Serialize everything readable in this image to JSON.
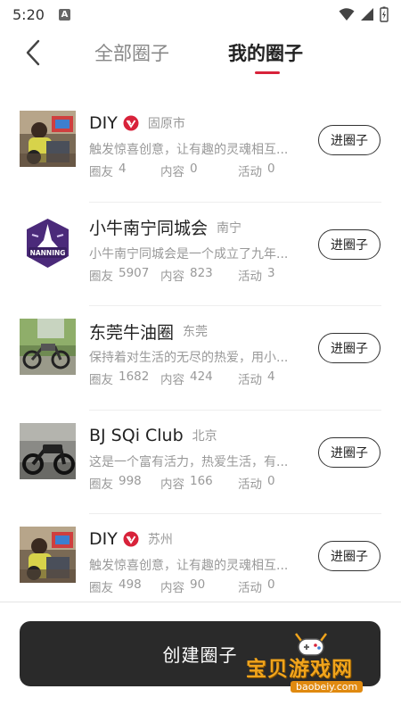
{
  "status_bar": {
    "time": "5:20",
    "notification_letter": "A"
  },
  "header": {
    "tabs": [
      {
        "label": "全部圈子",
        "active": false
      },
      {
        "label": "我的圈子",
        "active": true
      }
    ],
    "accent_color": "#d8223a"
  },
  "circles": [
    {
      "title": "DIY",
      "verified": true,
      "city": "固原市",
      "description": "触发惊喜创意，让有趣的灵魂相互...",
      "members_label": "圈友",
      "members": "4",
      "content_label": "内容",
      "content": "0",
      "activity_label": "活动",
      "activity": "0",
      "join_label": "进圈子"
    },
    {
      "title": "小牛南宁同城会",
      "verified": false,
      "city": "南宁",
      "description": "小牛南宁同城会是一个成立了九年...",
      "members_label": "圈友",
      "members": "5907",
      "content_label": "内容",
      "content": "823",
      "activity_label": "活动",
      "activity": "3",
      "join_label": "进圈子",
      "logo_text": "NANNING"
    },
    {
      "title": "东莞牛油圈",
      "verified": false,
      "city": "东莞",
      "description": "保持着对生活的无尽的热爱，用小...",
      "members_label": "圈友",
      "members": "1682",
      "content_label": "内容",
      "content": "424",
      "activity_label": "活动",
      "activity": "4",
      "join_label": "进圈子"
    },
    {
      "title": "BJ SQi Club",
      "verified": false,
      "city": "北京",
      "description": "这是一个富有活力，热爱生活，有...",
      "members_label": "圈友",
      "members": "998",
      "content_label": "内容",
      "content": "166",
      "activity_label": "活动",
      "activity": "0",
      "join_label": "进圈子"
    },
    {
      "title": "DIY",
      "verified": true,
      "city": "苏州",
      "description": "触发惊喜创意，让有趣的灵魂相互...",
      "members_label": "圈友",
      "members": "498",
      "content_label": "内容",
      "content": "90",
      "activity_label": "活动",
      "activity": "0",
      "join_label": "进圈子"
    }
  ],
  "create_button": {
    "label": "创建圈子"
  },
  "watermark": {
    "text": "宝贝游戏网",
    "url": "baobeiy.com"
  }
}
